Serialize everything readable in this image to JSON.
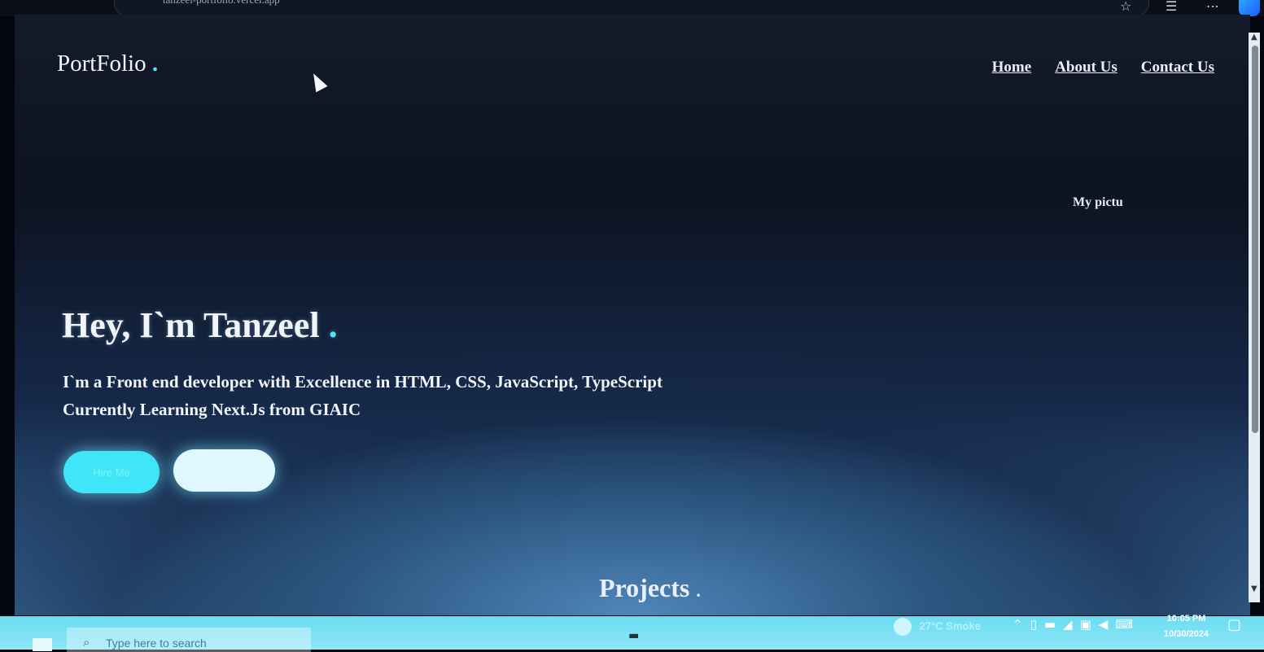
{
  "browser": {
    "address": "tanzeel-portfolio.vercel.app",
    "icons": [
      "star-icon",
      "favorites-icon",
      "more-icon",
      "copilot-icon"
    ]
  },
  "site": {
    "brand": "PortFolio",
    "brand_dot": ".",
    "nav": {
      "home": "Home",
      "about": "About Us",
      "contact": "Contact Us"
    },
    "broken_image_alt": "My pictu",
    "hero": {
      "title": "Hey, I`m Tanzeel",
      "title_dot": ".",
      "line1": "I`m a Front end developer with Excellence in HTML, CSS, JavaScript, TypeScript",
      "line2": "Currently Learning Next.Js from GIAIC"
    },
    "buttons": {
      "primary": "Hire Me",
      "secondary": "Download CV"
    },
    "projects_title": "Projects",
    "projects_dot": "."
  },
  "taskbar": {
    "search_placeholder": "Type here to search",
    "weather": "27°C Smoke",
    "time": "10:05 PM",
    "date": "10/30/2024"
  },
  "colors": {
    "accent": "#4fe3ff",
    "button_primary": "#3ee6f7",
    "button_secondary": "#dff8ff",
    "taskbar": "#7fe1f4"
  }
}
